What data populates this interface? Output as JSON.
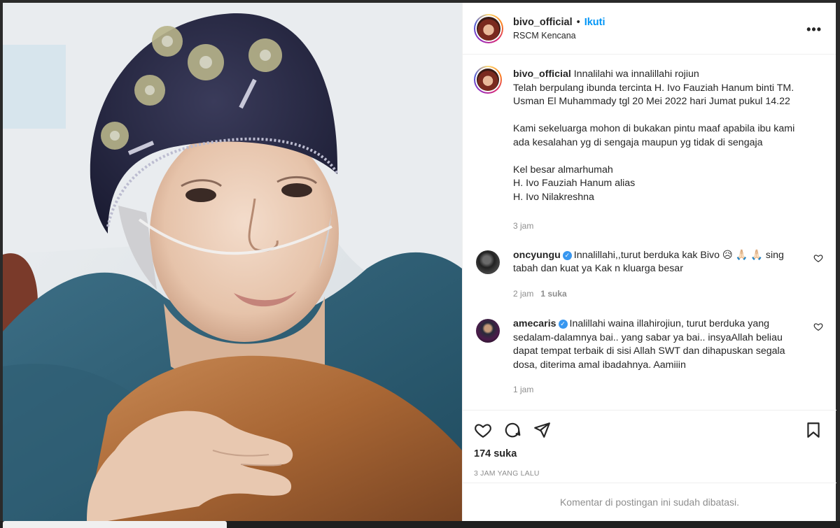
{
  "post": {
    "username": "bivo_official",
    "follow_label": "Ikuti",
    "location": "RSCM Kencana",
    "more_label": "•••"
  },
  "caption": {
    "username": "bivo_official",
    "text": "Innalilahi wa innalillahi rojiun\nTelah berpulang ibunda tercinta H. Ivo Fauziah Hanum binti TM. Usman El Muhammady tgl 20 Mei 2022 hari Jumat pukul 14.22\n\nKami sekeluarga mohon di bukakan pintu maaf apabila ibu kami ada kesalahan yg di sengaja maupun yg tidak di sengaja\n\nKel besar almarhumah\nH. Ivo Fauziah Hanum alias\nH. Ivo Nilakreshna",
    "time": "3 jam"
  },
  "comments": [
    {
      "username": "oncyungu",
      "text": "Innalillahi,,turut berduka kak Bivo 😥 🙏🏻 🙏🏻 sing tabah dan kuat ya Kak n kluarga besar",
      "time": "2 jam",
      "likes": "1 suka"
    },
    {
      "username": "amecaris",
      "text": "Inalillahi waina illahirojiun, turut berduka yang sedalam-dalamnya bai.. yang sabar ya bai.. insyaAllah beliau dapat tempat terbaik di sisi Allah SWT dan dihapuskan segala dosa, diterima amal ibadahnya. Aamiiin",
      "time": "1 jam"
    }
  ],
  "footer": {
    "likes": "174 suka",
    "time_ago": "3 JAM YANG LALU",
    "comments_limited": "Komentar di postingan ini sudah dibatasi."
  },
  "icons": {
    "like": "heart-icon",
    "comment": "comment-icon",
    "share": "send-icon",
    "save": "bookmark-icon",
    "verified": "verified-badge-icon"
  },
  "colors": {
    "link": "#0095f6",
    "muted": "#8e8e8e",
    "verified": "#3897f0"
  }
}
